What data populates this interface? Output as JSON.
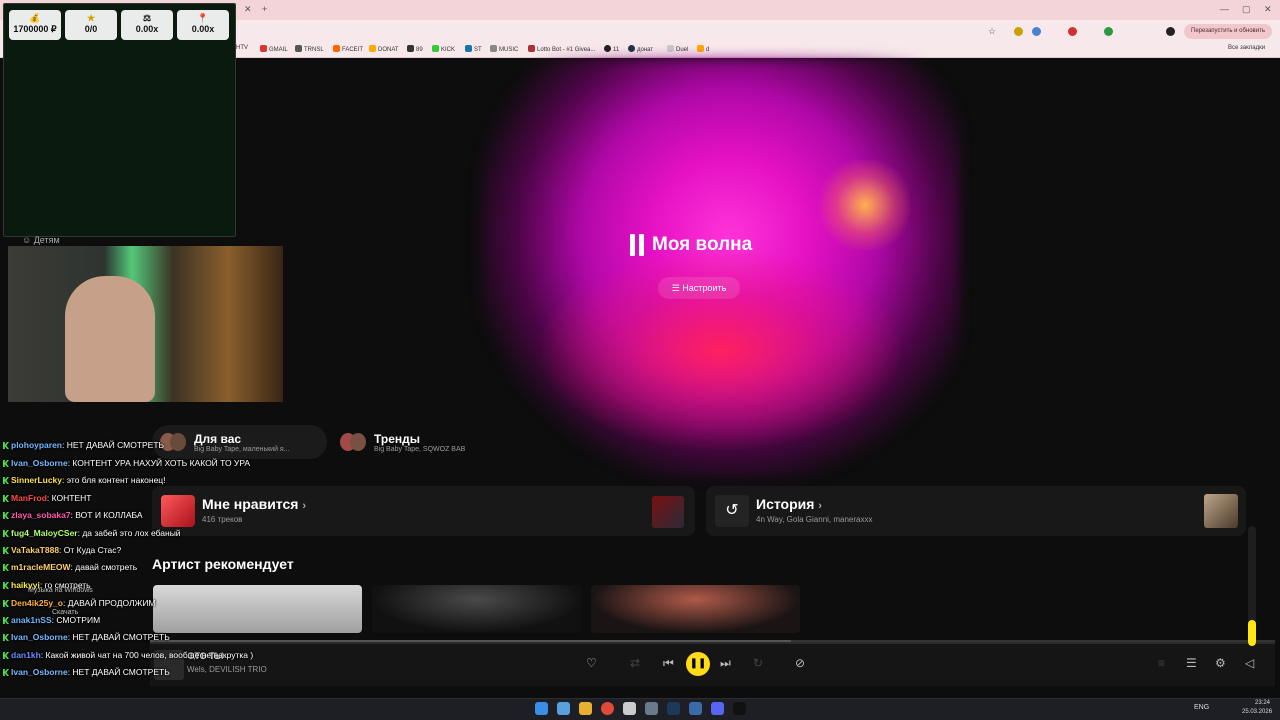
{
  "browser": {
    "bookmarks": [
      "HTV",
      "GMAIL",
      "TRNSL",
      "FACEIT",
      "DONAT",
      "89",
      "KICK",
      "ST",
      "MUSIC",
      "Lotto Bot - #1 Givea...",
      "11",
      "донат",
      "Duel",
      "d"
    ],
    "relaunch_label": "Перезапустить и обновить",
    "all_bookmarks": "Все закладки"
  },
  "stats": [
    {
      "icon": "money-bag-icon",
      "glyph": "💰",
      "value": "1700000 ₽"
    },
    {
      "icon": "star-icon",
      "glyph": "★",
      "value": "0/0"
    },
    {
      "icon": "scale-icon",
      "glyph": "⚖",
      "value": "0.00x"
    },
    {
      "icon": "pin-icon",
      "glyph": "📍",
      "value": "0.00x"
    }
  ],
  "sidebar_partial": {
    "kids_label": "Детям"
  },
  "main": {
    "wave_title": "Моя волна",
    "tune_label": "Настроить",
    "chips": [
      {
        "title": "Для вас",
        "sub": "Big Baby Tape, маленький я..."
      },
      {
        "title": "Тренды",
        "sub": "Big Baby Tape, SQWOZ BAB"
      }
    ],
    "likes": {
      "title": "Мне нравится",
      "count": "416 треков"
    },
    "history": {
      "title": "История",
      "sub": "4n Way, Gola Gianni, maneraxxx"
    },
    "artist_heading": "Артист рекомендует"
  },
  "player": {
    "artists": "Wels, DEVILISH TRIO",
    "track_title": "ЭТО ТЫ"
  },
  "chat": [
    {
      "user": "plohoyparen",
      "color": "#6fb6ff",
      "text": "НЕТ ДАВАЙ СМОТРЕТЬ"
    },
    {
      "user": "Ivan_Osborne",
      "color": "#7ab8ff",
      "text": "КОНТЕНТ УРА НАХУЙ ХОТЬ КАКОЙ ТО УРА"
    },
    {
      "user": "SinnerLucky",
      "color": "#ffe04a",
      "text": "это бля контент наконец!"
    },
    {
      "user": "ManFrod",
      "color": "#ff4a4a",
      "text": "КОНТЕНТ"
    },
    {
      "user": "zlaya_sobaka7",
      "color": "#ff5ab0",
      "text": "ВОТ И КОЛЛАБА"
    },
    {
      "user": "fug4_MaloyCSer",
      "color": "#b0ff6a",
      "text": "да забей это лох ебаный"
    },
    {
      "user": "VaTakaT888",
      "color": "#ffd06a",
      "text": "От Куда Стас?"
    },
    {
      "user": "m1racleMEOW",
      "color": "#ffd06a",
      "text": "давай смотреть"
    },
    {
      "user": "haikyyi",
      "color": "#ffea4a",
      "text": "го смотреть"
    },
    {
      "user": "Den4ik25y_o",
      "color": "#ffb03a",
      "text": "ДАВАЙ ПРОДОЛЖИМ"
    },
    {
      "user": "anak1nSS",
      "color": "#6ab8ff",
      "text": "СМОТРИМ"
    },
    {
      "user": "Ivan_Osborne",
      "color": "#7ab8ff",
      "text": "НЕТ ДАВАЙ СМОТРЕТЬ"
    },
    {
      "user": "dan1kh",
      "color": "#6a8aff",
      "text": "Какой живой чат на 700 челов, вообще не накрутка )"
    },
    {
      "user": "Ivan_Osborne",
      "color": "#7ab8ff",
      "text": "НЕТ ДАВАЙ СМОТРЕТЬ"
    }
  ],
  "overlay_text": {
    "music_windows": "Музыка на Windows",
    "download": "Скачать"
  },
  "taskbar": {
    "lang": "ENG",
    "time": "23:24",
    "date": "25.03.2026"
  }
}
